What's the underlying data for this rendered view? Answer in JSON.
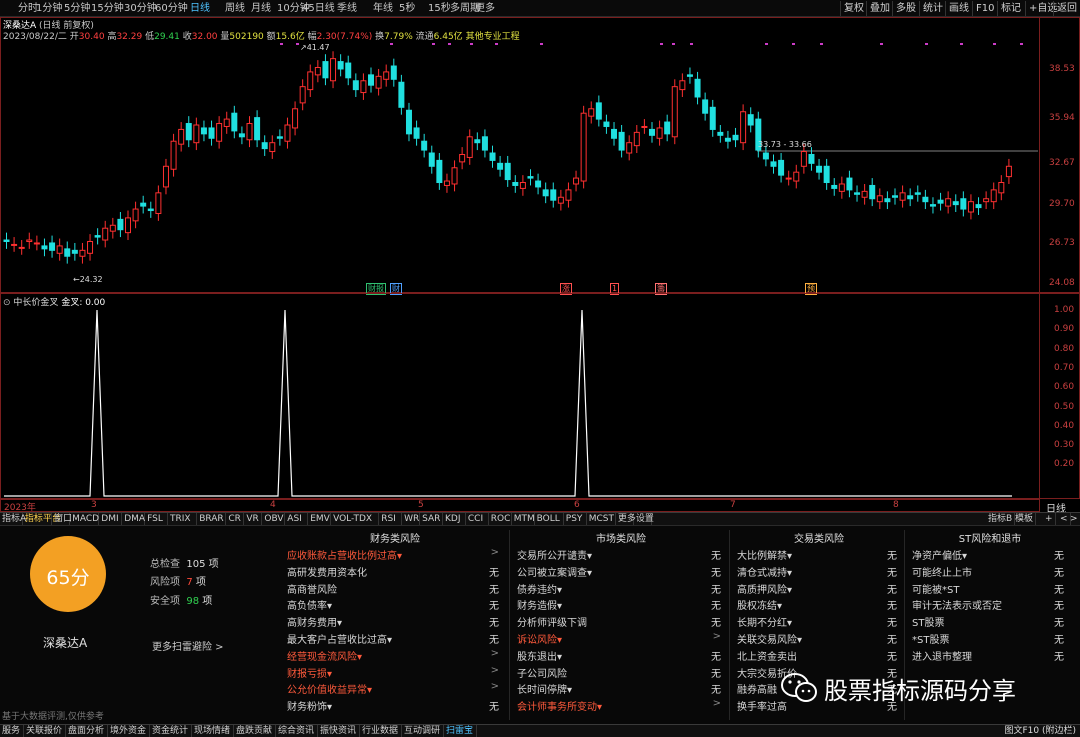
{
  "toolbar": {
    "periods": [
      "分时",
      "1分钟",
      "5分钟",
      "15分钟",
      "30分钟",
      "60分钟",
      "日线",
      "周线",
      "月线",
      "10分钟",
      "45日线",
      "季线",
      "年线",
      "5秒",
      "15秒",
      "多周期",
      "更多"
    ],
    "active_period": "日线",
    "right_buttons": [
      "复权",
      "叠加",
      "多股",
      "统计",
      "画线",
      "F10",
      "标记",
      "+自选",
      "返回"
    ]
  },
  "stock": {
    "name": "深桑达A",
    "mode": "(日线 前复权)",
    "date": "2023/08/22/二",
    "open_label": "开",
    "open": "30.40",
    "high_label": "高",
    "high": "32.29",
    "low_label": "低",
    "low": "29.41",
    "close_label": "收",
    "close": "32.00",
    "volume_label": "量",
    "volume": "502190",
    "amount_label": "额",
    "amount": "15.6亿",
    "change_label": "幅",
    "change": "2.30(7.74%)",
    "turnover_label": "换",
    "turnover": "7.79%",
    "float_label": "流通",
    "float": "6.45亿",
    "industry": "其他专业工程"
  },
  "main_chart": {
    "y_ticks": [
      "38.53",
      "35.94",
      "32.67",
      "29.70",
      "26.73",
      "24.08"
    ],
    "high_marker": "41.47",
    "low_marker": "24.32",
    "range_label": "33.73 - 33.66",
    "event_tags": [
      {
        "label": "财报",
        "color": "#30c070"
      },
      {
        "label": "财",
        "color": "#4fa0ff"
      },
      {
        "label": "涨",
        "color": "#ff5050"
      },
      {
        "label": "1",
        "color": "#ff5050"
      },
      {
        "label": "籌",
        "color": "#ff7070"
      },
      {
        "label": "预",
        "color": "#ffb040"
      }
    ]
  },
  "indicator": {
    "name": "中长价金叉",
    "value_label": "金叉: 0.00",
    "y_ticks": [
      "1.00",
      "0.90",
      "0.80",
      "0.70",
      "0.60",
      "0.50",
      "0.40",
      "0.30",
      "0.20"
    ],
    "x_ticks": [
      "2023年",
      "3",
      "4",
      "5",
      "6",
      "7",
      "8"
    ],
    "right_label": "日线"
  },
  "indicator_tabs": [
    "指标A",
    "指标平台",
    "窗口",
    "MACD",
    "DMI",
    "DMA",
    "FSL",
    "TRIX",
    "BRAR",
    "CR",
    "VR",
    "OBV",
    "ASI",
    "EMV",
    "VOL-TDX",
    "RSI",
    "WR",
    "SAR",
    "KDJ",
    "CCI",
    "ROC",
    "MTM",
    "BOLL",
    "PSY",
    "MCST",
    "更多",
    "设置"
  ],
  "indicator_tabs_right": [
    "指标B",
    "模板",
    "+",
    "<",
    ">"
  ],
  "risk": {
    "score": "65分",
    "stock_name": "深桑达A",
    "total_label": "总检查",
    "total": "105 项",
    "risk_label": "风险项",
    "risk_count": "7",
    "risk_unit": "项",
    "safe_label": "安全项",
    "safe_count": "98",
    "safe_unit": "项",
    "more_link": "更多扫雷避险 >",
    "disclaimer": "基于大数据评测,仅供参考",
    "columns": [
      {
        "title": "财务类风险",
        "rows": [
          {
            "label": "应收账款占营收比例过高▾",
            "value": ">",
            "red": true
          },
          {
            "label": "高研发费用资本化",
            "value": "无",
            "red": false
          },
          {
            "label": "高商誉风险",
            "value": "无",
            "red": false
          },
          {
            "label": "高负债率▾",
            "value": "无",
            "red": false
          },
          {
            "label": "高财务费用▾",
            "value": "无",
            "red": false
          },
          {
            "label": "最大客户占营收比过高▾",
            "value": "无",
            "red": false
          },
          {
            "label": "经营现金流风险▾",
            "value": ">",
            "red": true
          },
          {
            "label": "财报亏损▾",
            "value": ">",
            "red": true
          },
          {
            "label": "公允价值收益异常▾",
            "value": ">",
            "red": true
          },
          {
            "label": "财务粉饰▾",
            "value": "无",
            "red": false
          }
        ]
      },
      {
        "title": "市场类风险",
        "rows": [
          {
            "label": "交易所公开谴责▾",
            "value": "无",
            "red": false
          },
          {
            "label": "公司被立案调查▾",
            "value": "无",
            "red": false
          },
          {
            "label": "债券违约▾",
            "value": "无",
            "red": false
          },
          {
            "label": "财务造假▾",
            "value": "无",
            "red": false
          },
          {
            "label": "分析师评级下调",
            "value": "无",
            "red": false
          },
          {
            "label": "诉讼风险▾",
            "value": ">",
            "red": true
          },
          {
            "label": "股东退出▾",
            "value": "无",
            "red": false
          },
          {
            "label": "子公司风险",
            "value": "无",
            "red": false
          },
          {
            "label": "长时间停牌▾",
            "value": "无",
            "red": false
          },
          {
            "label": "会计师事务所变动▾",
            "value": ">",
            "red": true
          }
        ]
      },
      {
        "title": "交易类风险",
        "rows": [
          {
            "label": "大比例解禁▾",
            "value": "无",
            "red": false
          },
          {
            "label": "清仓式减持▾",
            "value": "无",
            "red": false
          },
          {
            "label": "高质押风险▾",
            "value": "无",
            "red": false
          },
          {
            "label": "股权冻结▾",
            "value": "无",
            "red": false
          },
          {
            "label": "长期不分红▾",
            "value": "无",
            "red": false
          },
          {
            "label": "关联交易风险▾",
            "value": "无",
            "red": false
          },
          {
            "label": "北上资金卖出",
            "value": "无",
            "red": false
          },
          {
            "label": "大宗交易折价",
            "value": "无",
            "red": false
          },
          {
            "label": "融券高融",
            "value": "无",
            "red": false
          },
          {
            "label": "换手率过高",
            "value": "无",
            "red": false
          }
        ]
      },
      {
        "title": "ST风险和退市",
        "rows": [
          {
            "label": "净资产偏低▾",
            "value": "无",
            "red": false
          },
          {
            "label": "可能终止上市",
            "value": "无",
            "red": false
          },
          {
            "label": "可能被*ST",
            "value": "无",
            "red": false
          },
          {
            "label": "审计无法表示或否定",
            "value": "无",
            "red": false
          },
          {
            "label": "ST股票",
            "value": "无",
            "red": false
          },
          {
            "label": "*ST股票",
            "value": "无",
            "red": false
          },
          {
            "label": "进入退市整理",
            "value": "无",
            "red": false
          }
        ]
      }
    ]
  },
  "watermark": "股票指标源码分享",
  "bottom_tabs": [
    "服务",
    "关联报价",
    "盘面分析",
    "境外资金",
    "资金统计",
    "现场情绪",
    "盘跌贡献",
    "综合资讯",
    "振快资讯",
    "行业数据",
    "互动调研",
    "扫雷宝"
  ],
  "bottom_active": "扫雷宝",
  "bottom_right": "图文F10 (附边栏)",
  "colors": {
    "up": "#ff3030",
    "down": "#20e0e0",
    "frame": "#7a1e1e",
    "accent": "#f3a023"
  }
}
